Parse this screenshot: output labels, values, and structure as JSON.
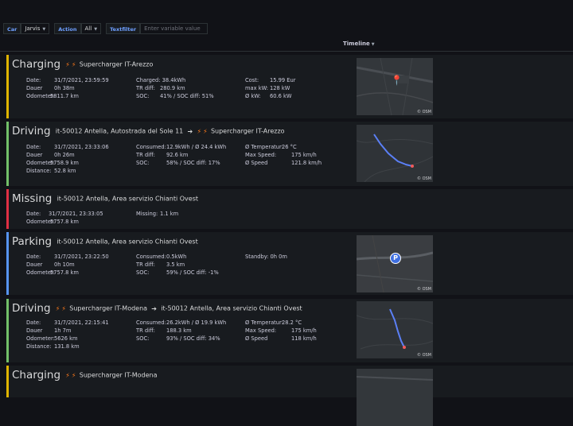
{
  "filters": {
    "car_label": "Car",
    "car_value": "Jarvis",
    "action_label": "Action",
    "action_value": "All",
    "textfilter_label": "Textfilter",
    "textfilter_placeholder": "Enter variable value"
  },
  "timeline_header": "Timeline",
  "map_attribution": "© OSM",
  "rows": [
    {
      "type": "Charging",
      "location": "Supercharger IT-Arezzo",
      "date_label": "Date:",
      "date": "31/7/2021, 23:59:59",
      "dauer_label": "Dauer",
      "dauer": "0h 38m",
      "odometer_label": "Odometer:",
      "odometer": "5811.7 km",
      "charged": "Charged: 38.4kWh",
      "tr_label": "TR diff:",
      "tr": "280.9 km",
      "soc_label": "SOC:",
      "soc": "41% / SOC diff: 51%",
      "cost_label": "Cost:",
      "cost": "15.99 Eur",
      "maxkw_label": "max kW:",
      "maxkw": "128 kW",
      "avgkw_label": "Ø kW:",
      "avgkw": "60.6 kW"
    },
    {
      "type": "Driving",
      "from": "it-50012 Antella, Autostrada del Sole 11",
      "to": "Supercharger IT-Arezzo",
      "date_label": "Date:",
      "date": "31/7/2021, 23:33:06",
      "dauer_label": "Dauer",
      "dauer": "0h 26m",
      "odometer_label": "Odometer:",
      "odometer": "5758.9 km",
      "distance_label": "Distance:",
      "distance": "52.8 km",
      "consumed_label": "Consumed:",
      "consumed": "12.9kWh / Ø 24.4 kWh",
      "tr_label": "TR diff:",
      "tr": "92.6 km",
      "soc_label": "SOC:",
      "soc": "58% / SOC diff: 17%",
      "temp_label": "Ø Temperatur:",
      "temp": "26 °C",
      "maxspeed_label": "Max Speed:",
      "maxspeed": "175 km/h",
      "avgspeed_label": "Ø Speed",
      "avgspeed": "121.8 km/h"
    },
    {
      "type": "Missing",
      "location": "it-50012 Antella, Area servizio Chianti Ovest",
      "date_label": "Date:",
      "date": "31/7/2021, 23:33:05",
      "odometer_label": "Odometer:",
      "odometer": "5757.8 km",
      "missing_label": "Missing:",
      "missing": "1.1 km"
    },
    {
      "type": "Parking",
      "location": "it-50012 Antella, Area servizio Chianti Ovest",
      "date_label": "Date:",
      "date": "31/7/2021, 23:22:50",
      "dauer_label": "Dauer",
      "dauer": "0h 10m",
      "odometer_label": "Odometer:",
      "odometer": "5757.8 km",
      "consumed_label": "Consumed:",
      "consumed": "0.5kWh",
      "tr_label": "TR diff:",
      "tr": "3.5 km",
      "soc_label": "SOC:",
      "soc": "59% / SOC diff: -1%",
      "standby": "Standby: 0h 0m"
    },
    {
      "type": "Driving",
      "from": "Supercharger IT-Modena",
      "to": "it-50012 Antella, Area servizio Chianti Ovest",
      "date_label": "Date:",
      "date": "31/7/2021, 22:15:41",
      "dauer_label": "Dauer",
      "dauer": "1h 7m",
      "odometer_label": "Odometer:",
      "odometer": "5626 km",
      "distance_label": "Distance:",
      "distance": "131.8 km",
      "consumed_label": "Consumed:",
      "consumed": "26.2kWh / Ø 19.9 kWh",
      "tr_label": "TR diff:",
      "tr": "188.3 km",
      "soc_label": "SOC:",
      "soc": "93% / SOC diff: 34%",
      "temp_label": "Ø Temperatur:",
      "temp": "28.2 °C",
      "maxspeed_label": "Max Speed:",
      "maxspeed": "175 km/h",
      "avgspeed_label": "Ø Speed",
      "avgspeed": "118 km/h"
    },
    {
      "type": "Charging",
      "location": "Supercharger IT-Modena"
    }
  ]
}
